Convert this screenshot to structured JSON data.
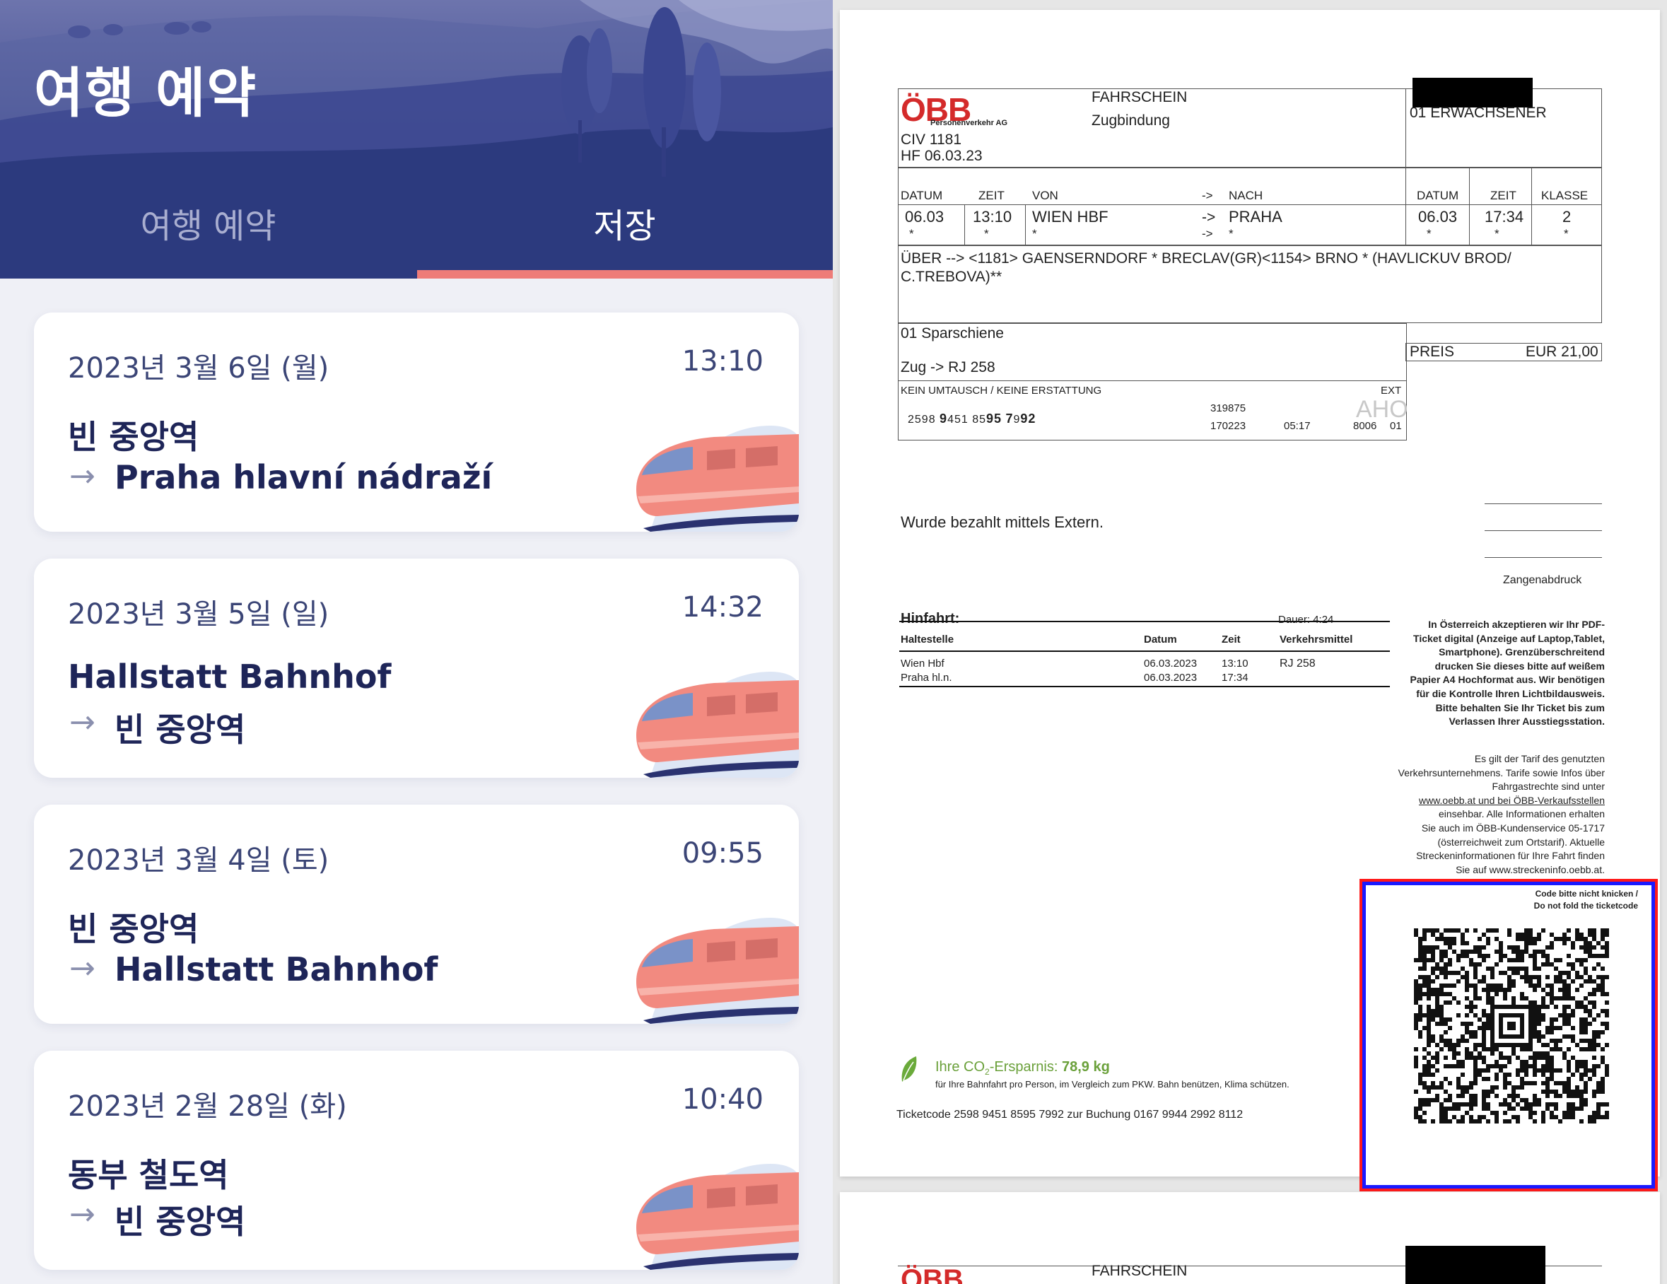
{
  "app": {
    "title": "여행 예약",
    "tabs": [
      {
        "label": "여행 예약",
        "active": false
      },
      {
        "label": "저장",
        "active": true
      }
    ],
    "colors": {
      "header": "#28377a",
      "accent": "#ee7c78",
      "text": "#1e2558"
    },
    "bookings": [
      {
        "date": "2023년 3월 6일 (월)",
        "time": "13:10",
        "from": "빈 중앙역",
        "arrow": "→",
        "to": "Praha hlavní nádraží"
      },
      {
        "date": "2023년 3월 5일 (일)",
        "time": "14:32",
        "from": "Hallstatt Bahnhof",
        "arrow": "→",
        "to": "빈 중앙역"
      },
      {
        "date": "2023년 3월 4일 (토)",
        "time": "09:55",
        "from": "빈 중앙역",
        "arrow": "→",
        "to": "Hallstatt Bahnhof"
      },
      {
        "date": "2023년 2월 28일 (화)",
        "time": "10:40",
        "from": "동부 철도역",
        "arrow": "→",
        "to": "빈 중앙역"
      }
    ]
  },
  "ticket": {
    "logo": "ÖBB",
    "logo_sub": "Personenverkehr AG",
    "doc_type": "FAHRSCHEIN",
    "binding": "Zugbindung",
    "civ": "CIV    1181",
    "hf": "HF 06.03.23",
    "passengers": "01 ERWACHSENER",
    "headers": {
      "datum": "DATUM",
      "zeit": "ZEIT",
      "von": "VON",
      "arrow": "->",
      "nach": "NACH",
      "datum2": "DATUM",
      "zeit2": "ZEIT",
      "klasse": "KLASSE"
    },
    "dep_date": "06.03",
    "dep_time": "13:10",
    "from": "WIEN HBF",
    "arrow": "->",
    "to": "PRAHA",
    "arr_date": "06.03",
    "arr_time": "17:34",
    "class": "2",
    "star": "*",
    "via_line1": "ÜBER --> <1181> GAENSERNDORF * BRECLAV(GR)<1154> BRNO * (HAVLICKUV BROD/",
    "via_line2": "C.TREBOVA)**",
    "tariff": "01 Sparschiene",
    "train": "Zug -> RJ 258",
    "price_label": "PREIS",
    "price_value": "EUR 21,00",
    "no_refund": "KEIN UMTAUSCH / KEINE ERSTATTUNG",
    "ext": "EXT",
    "serial_prefix": "2598 ",
    "serial_bold1": "9",
    "serial_mid": "451 85",
    "serial_bold2": "95",
    "serial_sp": " ",
    "serial_bold3": "7",
    "serial_mid2": "9",
    "serial_bold4": "92",
    "code1": "319875",
    "code2": "170223",
    "code_time": "05:17",
    "code3": "8006",
    "code4": "01",
    "aho": "AHO",
    "payment": "Wurde bezahlt mittels Extern.",
    "zangen": "Zangenabdruck",
    "itinerary": {
      "title": "Hinfahrt:",
      "duration": "Dauer: 4:24",
      "cols": [
        "Haltestelle",
        "Datum",
        "Zeit",
        "Verkehrsmittel"
      ],
      "rows": [
        {
          "stop": "Wien Hbf",
          "date": "06.03.2023",
          "time": "13:10",
          "vehicle": "RJ 258"
        },
        {
          "stop": "Praha hl.n.",
          "date": "06.03.2023",
          "time": "17:34",
          "vehicle": ""
        }
      ]
    },
    "notice_bold": [
      "In Österreich akzeptieren wir Ihr PDF-",
      "Ticket digital (Anzeige auf Laptop,Tablet,",
      "Smartphone). Grenzüberschreitend",
      "drucken Sie dieses bitte auf weißem",
      "Papier A4 Hochformat aus. Wir benötigen",
      "für die Kontrolle Ihren Lichtbildausweis.",
      "Bitte behalten Sie Ihr Ticket bis zum",
      "Verlassen Ihrer Ausstiegsstation."
    ],
    "notice_text": [
      "Es gilt der Tarif des genutzten",
      "Verkehrsunternehmens. Tarife sowie Infos über",
      "Fahrgastrechte sind unter",
      "www.oebb.at und bei ÖBB-Verkaufsstellen",
      "einsehbar. Alle Informationen erhalten",
      "Sie auch im ÖBB-Kundenservice 05-1717",
      "(österreichweit zum Ortstarif). Aktuelle",
      "Streckeninformationen für Ihre Fahrt finden",
      "Sie auf www.streckeninfo.oebb.at."
    ],
    "qr_caption1": "Code bitte nicht knicken /",
    "qr_caption2": "Do not fold the ticketcode",
    "co2_label_pre": "Ihre CO",
    "co2_sub": "2",
    "co2_label_post": "-Ersparnis: ",
    "co2_value": "78,9 kg",
    "co2_note": "für Ihre Bahnfahrt pro Person, im Vergleich zum PKW. Bahn benützen, Klima schützen.",
    "ticketcode": "Ticketcode 2598 9451 8595 7992 zur Buchung 0167 9944 2992 8112",
    "page2_doc_type": "FAHRSCHEIN"
  }
}
